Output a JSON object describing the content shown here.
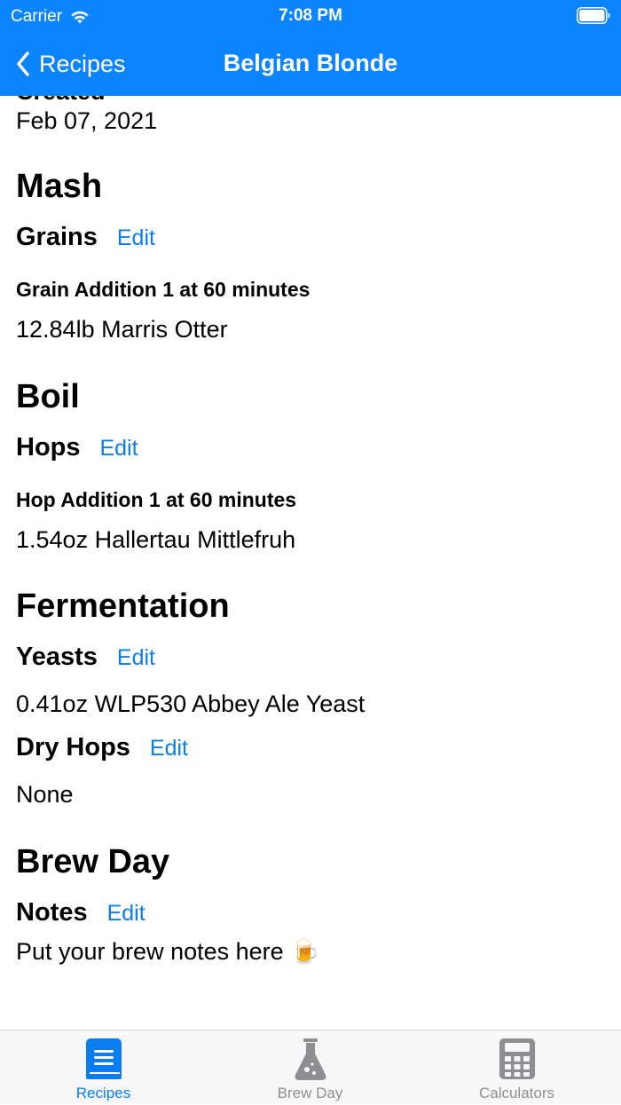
{
  "status_bar": {
    "carrier": "Carrier",
    "time": "7:08 PM"
  },
  "nav": {
    "back_label": "Recipes",
    "title": "Belgian Blonde"
  },
  "created": {
    "heading": "Created",
    "date": "Feb 07, 2021"
  },
  "mash": {
    "heading": "Mash",
    "grains_label": "Grains",
    "edit_label": "Edit",
    "addition_title": "Grain Addition 1 at 60 minutes",
    "addition_item": "12.84lb Marris Otter"
  },
  "boil": {
    "heading": "Boil",
    "hops_label": "Hops",
    "edit_label": "Edit",
    "addition_title": "Hop Addition 1 at 60 minutes",
    "addition_item": "1.54oz Hallertau Mittlefruh"
  },
  "fermentation": {
    "heading": "Fermentation",
    "yeasts_label": "Yeasts",
    "yeasts_edit": "Edit",
    "yeast_item": "0.41oz WLP530 Abbey Ale Yeast",
    "dry_hops_label": "Dry Hops",
    "dry_hops_edit": "Edit",
    "dry_hops_value": "None"
  },
  "brew_day": {
    "heading": "Brew Day",
    "notes_label": "Notes",
    "notes_edit": "Edit",
    "notes_text": "Put your brew notes here 🍺"
  },
  "tabbar": {
    "tabs": [
      {
        "label": "Recipes",
        "icon": "book-icon",
        "active": true
      },
      {
        "label": "Brew Day",
        "icon": "flask-icon",
        "active": false
      },
      {
        "label": "Calculators",
        "icon": "calculator-icon",
        "active": false
      }
    ]
  },
  "colors": {
    "accent": "#0a84ff",
    "link": "#0a7df2",
    "inactive_tab": "#8e8e93"
  }
}
